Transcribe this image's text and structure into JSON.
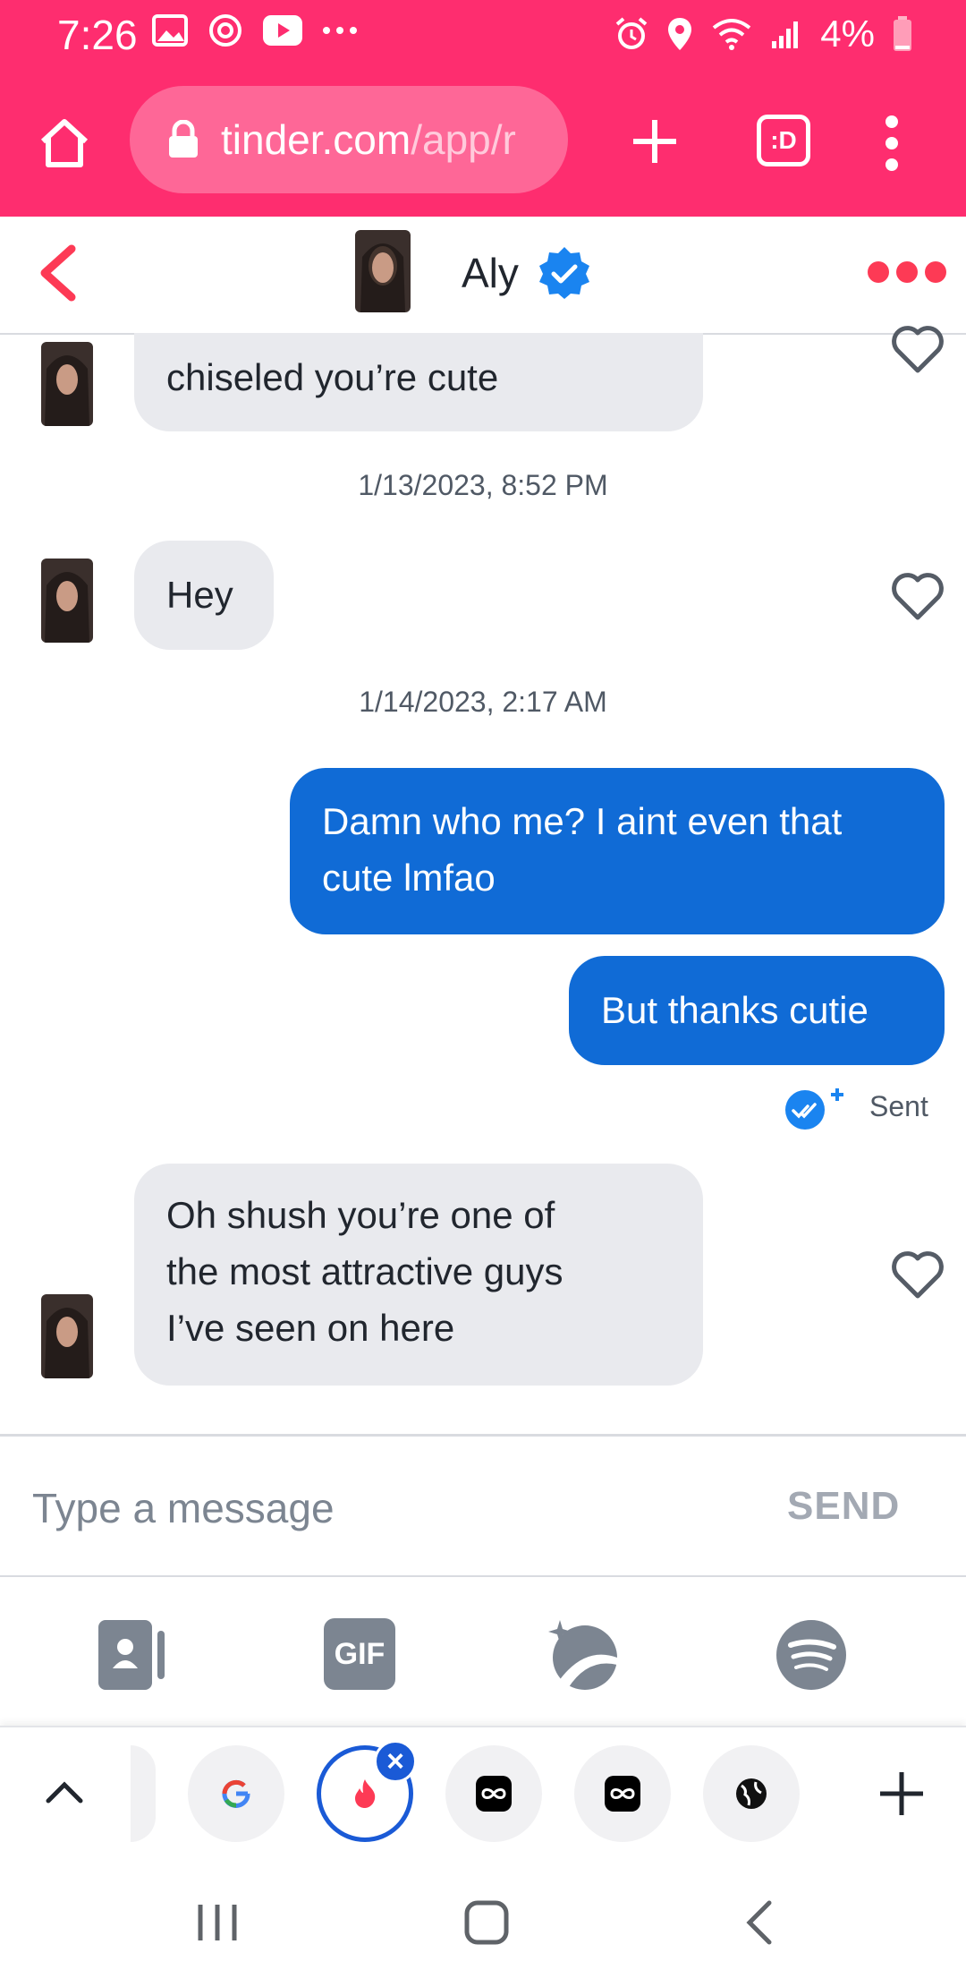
{
  "status_bar": {
    "time": "7:26",
    "battery": "4%",
    "left_icons": [
      "gallery-icon",
      "sync-icon",
      "youtube-icon",
      "more-icon"
    ],
    "right_icons": [
      "alarm-icon",
      "location-icon",
      "wifi-icon",
      "signal-icon",
      "battery-low-icon"
    ]
  },
  "browser": {
    "url_host": "tinder.com",
    "url_path": "/app/r",
    "tabs_badge": ":D",
    "accent_color": "#fe2d6f"
  },
  "chat_header": {
    "name": "Aly",
    "verified": true
  },
  "messages": [
    {
      "side": "in",
      "text": "chiseled you’re cute",
      "partial": true
    },
    {
      "type": "timestamp",
      "text": "1/13/2023, 8:52 PM"
    },
    {
      "side": "in",
      "text": "Hey"
    },
    {
      "type": "timestamp",
      "text": "1/14/2023, 2:17 AM"
    },
    {
      "side": "out",
      "lines": [
        "Damn who me? I aint even that",
        "cute lmfao"
      ]
    },
    {
      "side": "out",
      "text": "But thanks cutie"
    },
    {
      "type": "receipt",
      "text": "Sent"
    },
    {
      "side": "in",
      "lines": [
        "Oh shush you’re one of",
        "the most attractive guys",
        "I’ve seen on here"
      ]
    }
  ],
  "composer": {
    "placeholder": "Type a message",
    "send_label": "SEND",
    "tools": [
      "contact-card-icon",
      "gif-icon",
      "sticker-icon",
      "spotify-icon"
    ],
    "gif_label": "GIF"
  },
  "tab_strip": {
    "tabs": [
      "partial-tab",
      "google-tab",
      "tinder-tab",
      "infinity-tab",
      "infinity-tab",
      "globe-tab"
    ],
    "active": "tinder-tab"
  },
  "system_nav": [
    "recents-icon",
    "home-icon",
    "back-icon"
  ],
  "colors": {
    "outgoing_bubble": "#106bd6",
    "incoming_bubble": "#e9eaee",
    "tinder_red": "#fd3a55"
  }
}
